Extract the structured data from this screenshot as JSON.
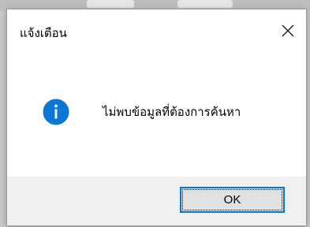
{
  "dialog": {
    "title": "แจ้งเตือน",
    "icon": "info-icon",
    "message": "ไม่พบข้อมูลที่ต้องการค้นหา",
    "ok_label": "OK",
    "close_icon": "close-icon"
  },
  "colors": {
    "info_icon_fill": "#0c77d4",
    "button_border": "#0078d7",
    "footer_bg": "#f0f0f0"
  }
}
